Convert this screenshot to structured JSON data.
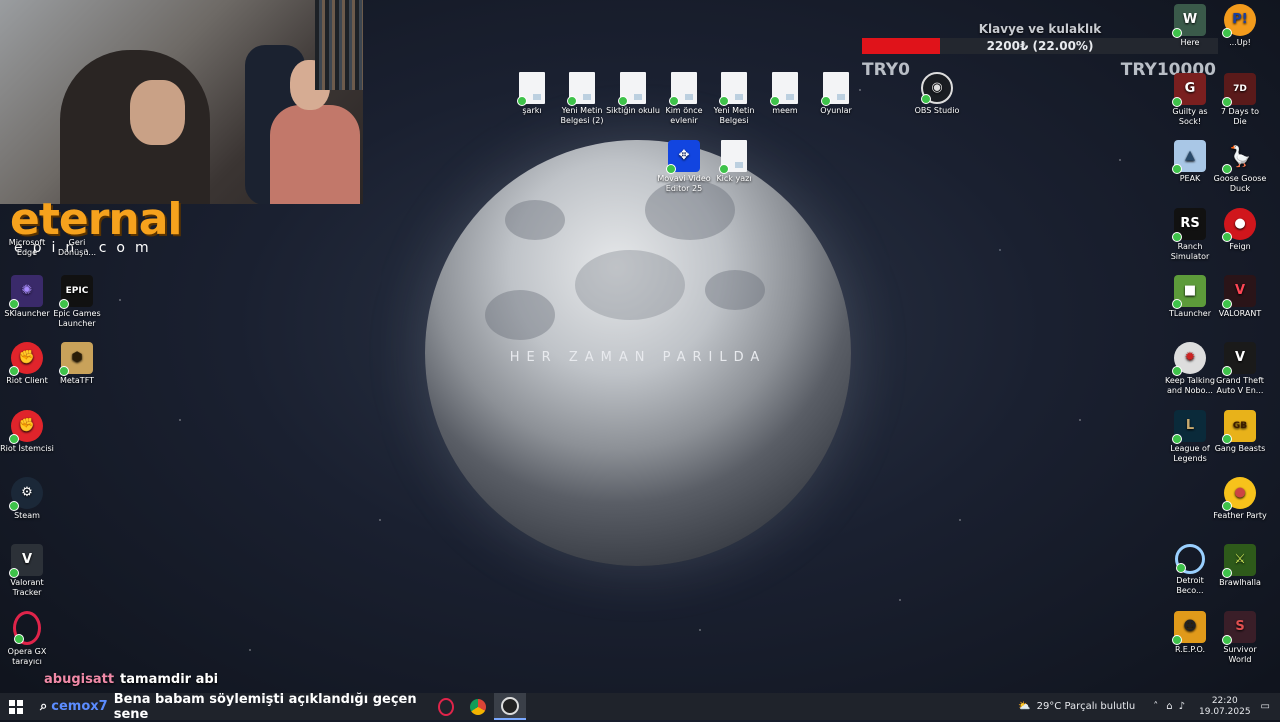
{
  "webcam": {
    "label": "webcam"
  },
  "overlay": {
    "brand_big": "eternal",
    "brand_small": "epin.com",
    "donation_title": "Klavye ve kulaklık",
    "donation_amount": "2200₺ (22.00%)",
    "donation_progress": 0.22,
    "donation_min": "TRY0",
    "donation_max": "TRY10000",
    "donation_color": "#e0131a"
  },
  "wallpaper": {
    "caption": "HER ZAMAN PARILDA"
  },
  "desktop": {
    "left_icons": [
      {
        "name": "Microsoft Edge",
        "label": "Microsoft\nEdge"
      },
      {
        "name": "Geri Dönüşüm",
        "label": "Geri\nDönüşü..."
      },
      {
        "name": "SKlauncher",
        "label": "SKlauncher"
      },
      {
        "name": "Epic Games Launcher",
        "label": "Epic Games\nLauncher"
      },
      {
        "name": "Riot Client",
        "label": "Riot Client"
      },
      {
        "name": "MetaTFT",
        "label": "MetaTFT"
      },
      {
        "name": "Riot İstemcisi",
        "label": "Riot İstemcisi"
      },
      {
        "name": "Steam",
        "label": "Steam"
      },
      {
        "name": "Valorant Tracker",
        "label": "Valorant\nTracker"
      },
      {
        "name": "Opera GX tarayıcı",
        "label": "Opera GX\ntarayıcı"
      }
    ],
    "top_files": [
      {
        "label": "şarkı"
      },
      {
        "label": "Yeni Metin\nBelgesi (2)"
      },
      {
        "label": "Siktiğin okulu"
      },
      {
        "label": "Kim önce\nevlenir"
      },
      {
        "label": "Yeni Metin\nBelgesi"
      },
      {
        "label": "meem"
      },
      {
        "label": "Oyunlar"
      },
      {
        "label": "OBS Studio"
      }
    ],
    "second_row": [
      {
        "label": "Movavi Video\nEditor 25"
      },
      {
        "label": "Kick yazı"
      }
    ],
    "right_icons": [
      {
        "label": "Here"
      },
      {
        "label": "...Up!"
      },
      {
        "label": "Guilty as\nSock!"
      },
      {
        "label": "7 Days to Die"
      },
      {
        "label": "PEAK"
      },
      {
        "label": "Goose Goose\nDuck"
      },
      {
        "label": "Ranch\nSimulator"
      },
      {
        "label": "Feign"
      },
      {
        "label": "TLauncher"
      },
      {
        "label": "VALORANT"
      },
      {
        "label": "Keep Talking\nand Nobo..."
      },
      {
        "label": "Grand Theft\nAuto V En..."
      },
      {
        "label": "League of\nLegends"
      },
      {
        "label": "Gang Beasts"
      },
      {
        "label": "Feather Party"
      },
      {
        "label": "Detroit\nBeco..."
      },
      {
        "label": "Brawlhalla"
      },
      {
        "label": "R.E.P.O."
      },
      {
        "label": "Survivor\nWorld"
      }
    ]
  },
  "chat": {
    "user": "abugisatt",
    "message": "tamamdir abi"
  },
  "taskbar": {
    "search_user": "cemox7",
    "search_message": "Bena babam söylemişti açıklandığı geçen sene",
    "weather": "29°C  Parçalı bulutlu",
    "time": "22:20",
    "date": "19.07.2025"
  }
}
